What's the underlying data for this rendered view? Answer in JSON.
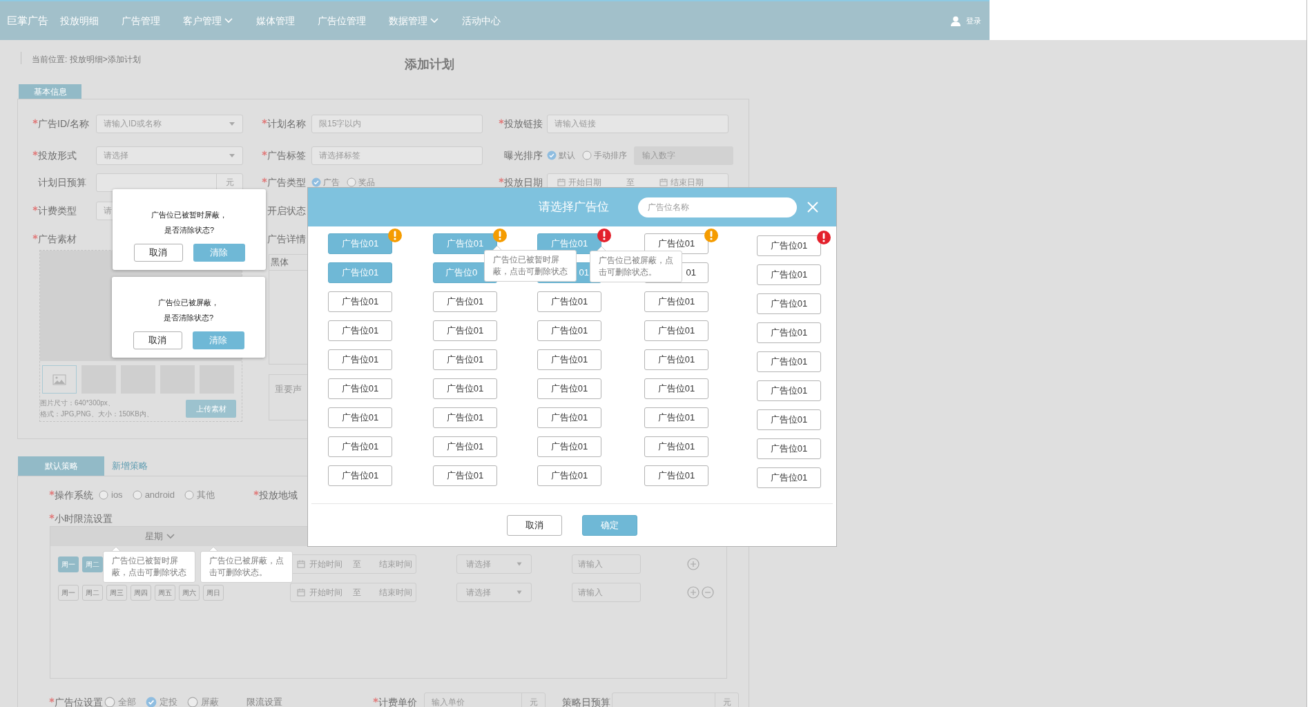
{
  "nav": {
    "brand": "巨掌广告",
    "items": [
      {
        "label": "投放明细",
        "has_menu": false
      },
      {
        "label": "广告管理",
        "has_menu": false
      },
      {
        "label": "客户管理",
        "has_menu": true
      },
      {
        "label": "媒体管理",
        "has_menu": false
      },
      {
        "label": "广告位管理",
        "has_menu": false
      },
      {
        "label": "数据管理",
        "has_menu": true
      },
      {
        "label": "活动中心",
        "has_menu": false
      }
    ],
    "user": "登录"
  },
  "breadcrumb": "当前位置: 投放明细>添加计划",
  "page_title": "添加计划",
  "basic_info": {
    "tab": "基本信息",
    "rows": [
      [
        {
          "label": "广告ID/名称",
          "required": true,
          "kind": "select",
          "placeholder": "请输入ID或名称"
        },
        {
          "label": "计划名称",
          "required": true,
          "kind": "input",
          "placeholder": "限15字以内"
        },
        {
          "label": "投放链接",
          "required": true,
          "kind": "input",
          "placeholder": "请输入链接"
        }
      ],
      [
        {
          "label": "投放形式",
          "required": true,
          "kind": "select",
          "placeholder": "请选择"
        },
        {
          "label": "广告标签",
          "required": true,
          "kind": "input",
          "placeholder": "请选择标签"
        },
        {
          "label": "曝光排序",
          "required": false,
          "kind": "radio",
          "options": [
            {
              "label": "默认",
              "checked": true
            },
            {
              "label": "手动排序",
              "checked": false
            }
          ],
          "extra_placeholder": "输入数字"
        }
      ],
      [
        {
          "label": "计划日预算",
          "required": false,
          "kind": "suffix",
          "suffix": "元"
        },
        {
          "label": "广告类型",
          "required": true,
          "kind": "radio",
          "options": [
            {
              "label": "广告",
              "checked": true
            },
            {
              "label": "奖品",
              "checked": false
            }
          ]
        },
        {
          "label": "投放日期",
          "required": true,
          "kind": "date_range",
          "start": "开始日期",
          "separator": "至",
          "end": "结束日期"
        }
      ],
      [
        {
          "label": "计费类型",
          "required": true,
          "kind": "input",
          "placeholder": "请"
        },
        {
          "label": "开启状态",
          "required": false,
          "kind": "label"
        }
      ]
    ],
    "material": {
      "label": "广告素材",
      "required": true,
      "notes": [
        "图片尺寸：640*300px、",
        "格式：JPG,PNG、大小：150KB内、"
      ],
      "upload": "上传素材"
    },
    "details": {
      "label": "广告详情",
      "font": "黑体",
      "notice": "重要声"
    }
  },
  "strategy": {
    "tabs": [
      {
        "label": "默认策略",
        "selected": true
      },
      {
        "label": "新增策略",
        "selected": false
      }
    ],
    "os": {
      "label": "操作系统",
      "required": true,
      "options": [
        {
          "label": "ios",
          "checked": false
        },
        {
          "label": "android",
          "checked": false
        },
        {
          "label": "其他",
          "checked": false
        }
      ]
    },
    "region": {
      "label": "投放地域",
      "required": true
    },
    "hourly": {
      "label": "小时限流设置",
      "required": true,
      "header": "星期",
      "rows": [
        {
          "days": [
            {
              "label": "周一",
              "selected": true
            },
            {
              "label": "周二",
              "selected": true
            }
          ],
          "start": "开始时间",
          "separator": "至",
          "end": "结束时间",
          "select": "请选择",
          "placeholder": "请输入",
          "removable": false
        },
        {
          "days": [
            {
              "label": "周一",
              "selected": false
            },
            {
              "label": "周二",
              "selected": false
            },
            {
              "label": "周三",
              "selected": false
            },
            {
              "label": "周四",
              "selected": false
            },
            {
              "label": "周五",
              "selected": false
            },
            {
              "label": "周六",
              "selected": false
            },
            {
              "label": "周日",
              "selected": false
            }
          ],
          "start": "开始时间",
          "separator": "至",
          "end": "结束时间",
          "select": "请选择",
          "placeholder": "请输入",
          "removable": true
        }
      ]
    },
    "slot_setting": {
      "label": "广告位设置",
      "required": true,
      "options": [
        {
          "label": "全部",
          "checked": false
        },
        {
          "label": "定投",
          "checked": true
        },
        {
          "label": "屏蔽",
          "checked": false
        }
      ],
      "link": "限流设置"
    },
    "price": {
      "label": "计费单价",
      "required": true,
      "placeholder": "输入单价",
      "suffix": "元"
    },
    "budget": {
      "label": "策略日预算",
      "required": false,
      "suffix": "元"
    }
  },
  "dialogs": [
    {
      "lines": [
        "广告位已被暂时屏蔽，",
        "是否清除状态?"
      ],
      "cancel": "取消",
      "confirm": "清除"
    },
    {
      "lines": [
        "广告位已被屏蔽，",
        "是否清除状态?"
      ],
      "cancel": "取消",
      "confirm": "清除"
    }
  ],
  "hint_tooltips": [
    {
      "text": "广告位已被暂时屏蔽，点击可删除状态"
    },
    {
      "text": "广告位已被屏蔽，点击可删除状态。"
    }
  ],
  "modal": {
    "title": "请选择广告位",
    "search_placeholder": "广告位名称",
    "slots": [
      [
        {
          "kind": "whole",
          "label": "广告位01",
          "selected": true,
          "color": "#f59c00"
        },
        {
          "kind": "whole",
          "label": "广告位01",
          "selected": true,
          "color": "#f59c00"
        },
        {
          "kind": "whole",
          "label": "广告位01",
          "selected": true,
          "color": "#e3202b"
        },
        {
          "kind": "whole",
          "label": "广告位01",
          "selected": false,
          "color": "#f59c00"
        },
        {
          "kind": "whole",
          "label": "广告位01",
          "selected": false,
          "color": "#e3202b"
        }
      ],
      [
        {
          "kind": "whole",
          "label": "广告位01",
          "selected": true
        },
        {
          "kind": "cut_end",
          "label": "广告位0",
          "selected": true
        },
        {
          "kind": "cut_start",
          "label": "01",
          "selected": true
        },
        {
          "kind": "cut_start",
          "label": "01",
          "selected": false
        },
        {
          "kind": "whole",
          "label": "广告位01",
          "selected": false
        }
      ],
      [
        {
          "kind": "whole",
          "label": "广告位01",
          "selected": false
        },
        {
          "kind": "whole",
          "label": "广告位01",
          "selected": false
        },
        {
          "kind": "whole",
          "label": "广告位01",
          "selected": false
        },
        {
          "kind": "whole",
          "label": "广告位01",
          "selected": false
        },
        {
          "kind": "whole",
          "label": "广告位01",
          "selected": false
        }
      ],
      [
        {
          "kind": "whole",
          "label": "广告位01",
          "selected": false
        },
        {
          "kind": "whole",
          "label": "广告位01",
          "selected": false
        },
        {
          "kind": "whole",
          "label": "广告位01",
          "selected": false
        },
        {
          "kind": "whole",
          "label": "广告位01",
          "selected": false
        },
        {
          "kind": "whole",
          "label": "广告位01",
          "selected": false
        }
      ],
      [
        {
          "kind": "whole",
          "label": "广告位01",
          "selected": false
        },
        {
          "kind": "whole",
          "label": "广告位01",
          "selected": false
        },
        {
          "kind": "whole",
          "label": "广告位01",
          "selected": false
        },
        {
          "kind": "whole",
          "label": "广告位01",
          "selected": false
        },
        {
          "kind": "whole",
          "label": "广告位01",
          "selected": false
        }
      ],
      [
        {
          "kind": "whole",
          "label": "广告位01",
          "selected": false
        },
        {
          "kind": "whole",
          "label": "广告位01",
          "selected": false
        },
        {
          "kind": "whole",
          "label": "广告位01",
          "selected": false
        },
        {
          "kind": "whole",
          "label": "广告位01",
          "selected": false
        },
        {
          "kind": "whole",
          "label": "广告位01",
          "selected": false
        }
      ],
      [
        {
          "kind": "whole",
          "label": "广告位01",
          "selected": false
        },
        {
          "kind": "whole",
          "label": "广告位01",
          "selected": false
        },
        {
          "kind": "whole",
          "label": "广告位01",
          "selected": false
        },
        {
          "kind": "whole",
          "label": "广告位01",
          "selected": false
        },
        {
          "kind": "whole",
          "label": "广告位01",
          "selected": false
        }
      ],
      [
        {
          "kind": "whole",
          "label": "广告位01",
          "selected": false
        },
        {
          "kind": "whole",
          "label": "广告位01",
          "selected": false
        },
        {
          "kind": "whole",
          "label": "广告位01",
          "selected": false
        },
        {
          "kind": "whole",
          "label": "广告位01",
          "selected": false
        },
        {
          "kind": "whole",
          "label": "广告位01",
          "selected": false
        }
      ],
      [
        {
          "kind": "whole",
          "label": "广告位01",
          "selected": false
        },
        {
          "kind": "whole",
          "label": "广告位01",
          "selected": false
        },
        {
          "kind": "whole",
          "label": "广告位01",
          "selected": false
        },
        {
          "kind": "whole",
          "label": "广告位01",
          "selected": false
        },
        {
          "kind": "whole",
          "label": "广告位01",
          "selected": false
        }
      ]
    ],
    "tooltips": [
      {
        "text": "广告位已被暂时屏蔽，点击可删除状态"
      },
      {
        "text": "广告位已被屏蔽，点击可删除状态。"
      }
    ],
    "cancel": "取消",
    "confirm": "确定"
  }
}
